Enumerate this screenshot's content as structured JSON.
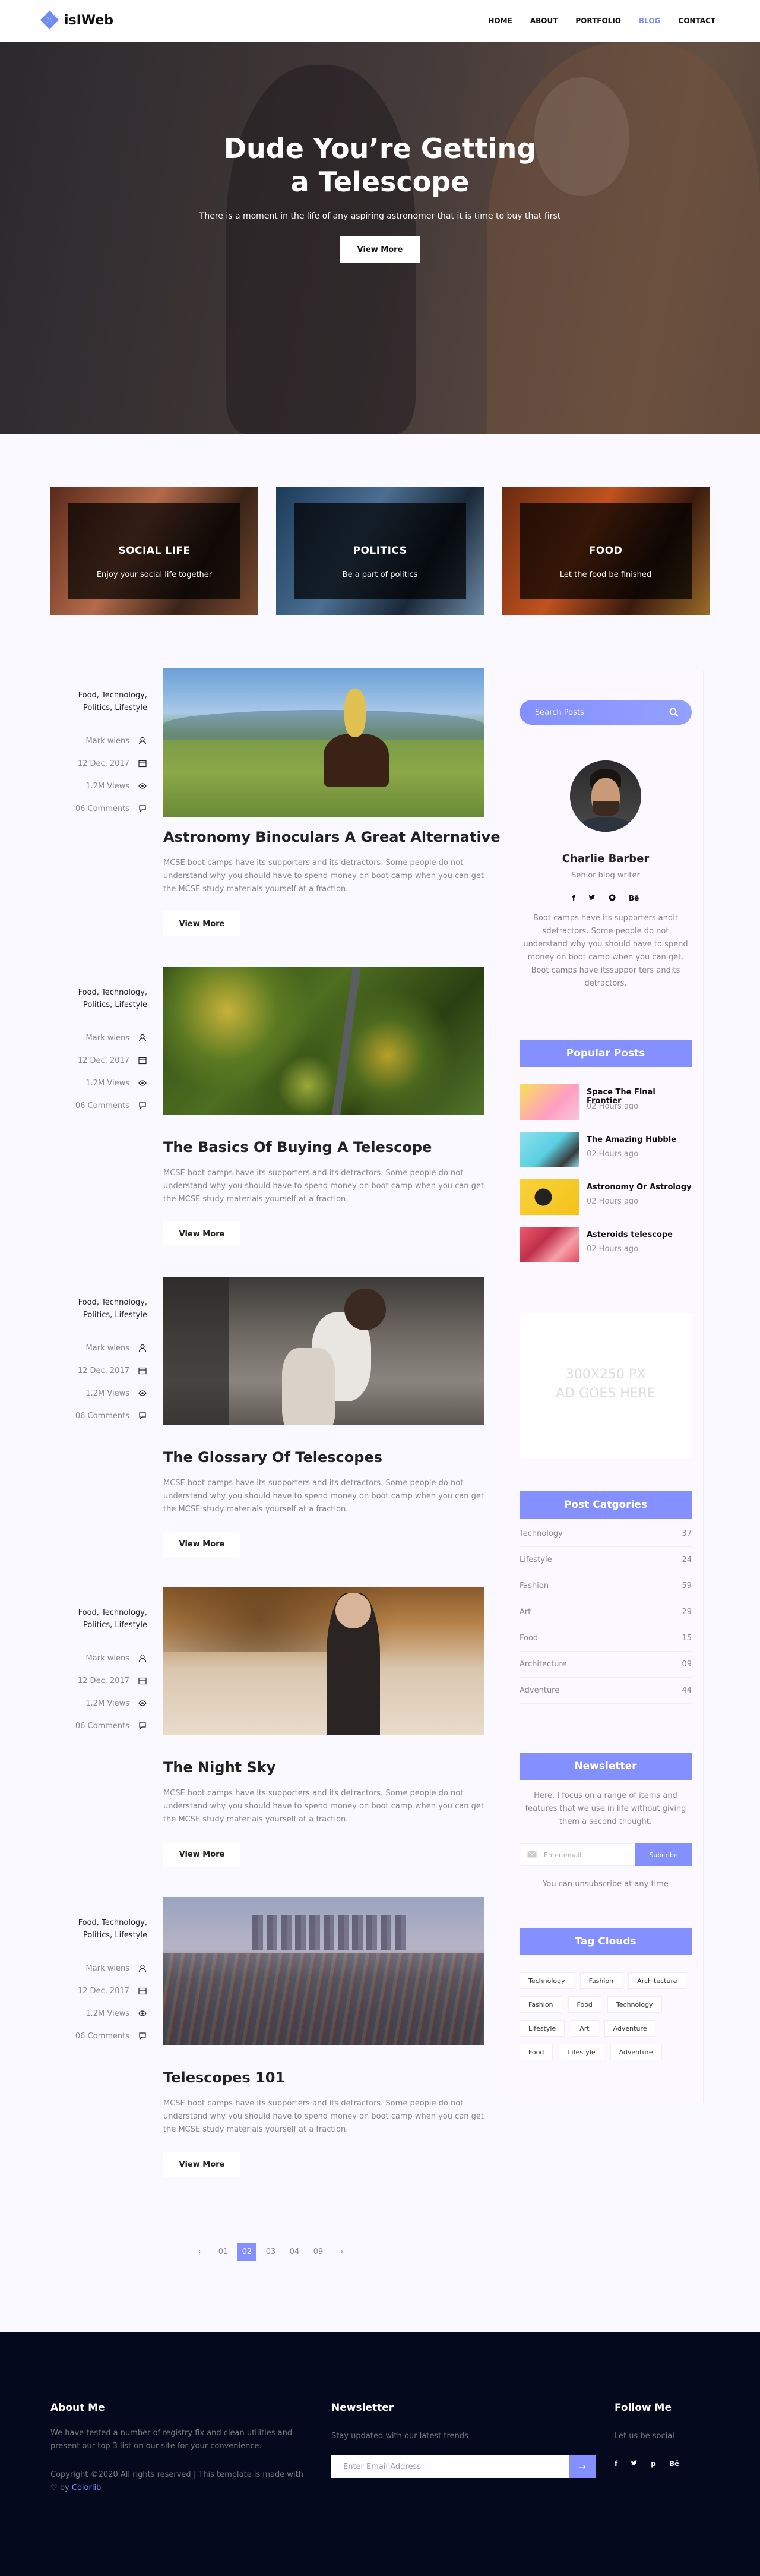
{
  "header": {
    "brand": "isIWeb",
    "nav": [
      {
        "label": "HOME",
        "active": false
      },
      {
        "label": "ABOUT",
        "active": false
      },
      {
        "label": "PORTFOLIO",
        "active": false
      },
      {
        "label": "BLOG",
        "active": true
      },
      {
        "label": "CONTACT",
        "active": false
      }
    ]
  },
  "hero": {
    "title_line1": "Dude You’re Getting",
    "title_line2": "a Telescope",
    "subtitle": "There is a moment in the life of any aspiring astronomer that it is time to buy that first",
    "button": "View More"
  },
  "categories": [
    {
      "title": "SOCIAL LIFE",
      "desc": "Enjoy your social life together"
    },
    {
      "title": "POLITICS",
      "desc": "Be a part of politics"
    },
    {
      "title": "FOOD",
      "desc": "Let the food be finished"
    }
  ],
  "posts": [
    {
      "tags": "Food, Technology, Politics, Lifestyle",
      "author": "Mark wiens",
      "date": "12 Dec, 2017",
      "views": "1.2M Views",
      "comments": "06 Comments",
      "title": "Astronomy Binoculars A Great Alternative",
      "excerpt": "MCSE boot camps have its supporters and its detractors. Some people do not understand why you should have to spend money on boot camp when you can get the MCSE study materials yourself at a fraction.",
      "button": "View More"
    },
    {
      "tags": "Food, Technology, Politics, Lifestyle",
      "author": "Mark wiens",
      "date": "12 Dec, 2017",
      "views": "1.2M Views",
      "comments": "06 Comments",
      "title": "The Basics Of Buying A Telescope",
      "excerpt": "MCSE boot camps have its supporters and its detractors. Some people do not understand why you should have to spend money on boot camp when you can get the MCSE study materials yourself at a fraction.",
      "button": "View More"
    },
    {
      "tags": "Food, Technology, Politics, Lifestyle",
      "author": "Mark wiens",
      "date": "12 Dec, 2017",
      "views": "1.2M Views",
      "comments": "06 Comments",
      "title": "The Glossary Of Telescopes",
      "excerpt": "MCSE boot camps have its supporters and its detractors. Some people do not understand why you should have to spend money on boot camp when you can get the MCSE study materials yourself at a fraction.",
      "button": "View More"
    },
    {
      "tags": "Food, Technology, Politics, Lifestyle",
      "author": "Mark wiens",
      "date": "12 Dec, 2017",
      "views": "1.2M Views",
      "comments": "06 Comments",
      "title": "The Night Sky",
      "excerpt": "MCSE boot camps have its supporters and its detractors. Some people do not understand why you should have to spend money on boot camp when you can get the MCSE study materials yourself at a fraction.",
      "button": "View More"
    },
    {
      "tags": "Food, Technology, Politics, Lifestyle",
      "author": "Mark wiens",
      "date": "12 Dec, 2017",
      "views": "1.2M Views",
      "comments": "06 Comments",
      "title": "Telescopes 101",
      "excerpt": "MCSE boot camps have its supporters and its detractors. Some people do not understand why you should have to spend money on boot camp when you can get the MCSE study materials yourself at a fraction.",
      "button": "View More"
    }
  ],
  "sidebar": {
    "search_placeholder": "Search Posts",
    "author": {
      "name": "Charlie Barber",
      "role": "Senior blog writer",
      "social": [
        "f",
        "t",
        "gh",
        "Bē"
      ],
      "bio": "Boot camps have its supporters andit sdetractors. Some people do not understand why you should have to spend money on boot camp when you can get. Boot camps have itssuppor ters andits detractors."
    },
    "popular_title": "Popular Posts",
    "popular": [
      {
        "title": "Space The Final Frontier",
        "time": "02 Hours ago"
      },
      {
        "title": "The Amazing Hubble",
        "time": "02 Hours ago"
      },
      {
        "title": "Astronomy Or Astrology",
        "time": "02 Hours ago"
      },
      {
        "title": "Asteroids telescope",
        "time": "02 Hours ago"
      }
    ],
    "ad_line1": "300X250 PX",
    "ad_line2": "AD GOES HERE",
    "categories_title": "Post Catgories",
    "post_categories": [
      {
        "name": "Technology",
        "count": "37"
      },
      {
        "name": "Lifestyle",
        "count": "24"
      },
      {
        "name": "Fashion",
        "count": "59"
      },
      {
        "name": "Art",
        "count": "29"
      },
      {
        "name": "Food",
        "count": "15"
      },
      {
        "name": "Architecture",
        "count": "09"
      },
      {
        "name": "Adventure",
        "count": "44"
      }
    ],
    "newsletter_title": "Newsletter",
    "newsletter_text": "Here, I focus on a range of items and features that we use in life without giving them a second thought.",
    "newsletter_placeholder": "Enter email",
    "newsletter_button": "Subcribe",
    "newsletter_note": "You can unsubscribe at any time",
    "tags_title": "Tag Clouds",
    "tags": [
      "Technology",
      "Fashion",
      "Architecture",
      "Fashion",
      "Food",
      "Technology",
      "Lifestyle",
      "Art",
      "Adventure",
      "Food",
      "Lifestyle",
      "Adventure"
    ]
  },
  "pagination": {
    "prev": "‹",
    "pages": [
      "01",
      "02",
      "03",
      "04",
      "09"
    ],
    "active": "02",
    "next": "›"
  },
  "footer": {
    "about_title": "About Me",
    "about_text": "We have tested a number of registry fix and clean utilities and present our top 3 list on our site for your convenience.",
    "copyright": "Copyright ©2020 All rights reserved | This template is made with",
    "heart": "♡",
    "by": "by",
    "colorlib": "Colorlib",
    "newsletter_title": "Newsletter",
    "newsletter_text": "Stay updated with our latest trends",
    "newsletter_placeholder": "Enter Email Address",
    "follow_title": "Follow Me",
    "follow_text": "Let us be social",
    "social": [
      "f",
      "t",
      "p",
      "Bē"
    ]
  },
  "colors": {
    "accent": "#8490ff",
    "footer_bg": "#04091e",
    "page_bg": "#f9f9ff"
  }
}
